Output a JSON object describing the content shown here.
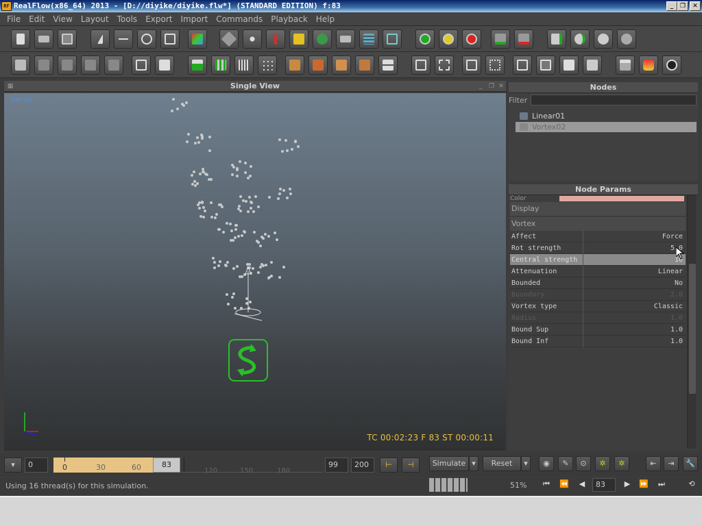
{
  "window": {
    "title": "RealFlow(x86_64) 2013 - [D://diyike/diyike.flw*] (STANDARD EDITION) f:83",
    "icon_text": "RF"
  },
  "menu": [
    "File",
    "Edit",
    "View",
    "Layout",
    "Tools",
    "Export",
    "Import",
    "Commands",
    "Playback",
    "Help"
  ],
  "viewport": {
    "title": "Single View",
    "camera": "persp",
    "timecode": "TC 00:02:23   F 83   ST 00:00:11"
  },
  "nodes": {
    "title": "Nodes",
    "filter_label": "Filter",
    "filter_value": "",
    "items": [
      {
        "name": "Linear01"
      },
      {
        "name": "Vortex02"
      }
    ]
  },
  "node_params": {
    "title": "Node Params",
    "color_label": "Color",
    "section_display": "Display",
    "section_vortex": "Vortex",
    "rows": [
      {
        "key": "Affect",
        "value": "Force"
      },
      {
        "key": "Rot strength",
        "value": "5.0"
      },
      {
        "key": "Central strength",
        "value": "10"
      },
      {
        "key": "Attenuation",
        "value": "Linear"
      },
      {
        "key": "Bounded",
        "value": "No"
      },
      {
        "key": "Boundary",
        "value": "2.0"
      },
      {
        "key": "Vortex type",
        "value": "Classic"
      },
      {
        "key": "Radius",
        "value": "1.0"
      },
      {
        "key": "Bound Sup",
        "value": "1.0"
      },
      {
        "key": "Bound Inf",
        "value": "1.0"
      }
    ]
  },
  "timeline": {
    "start": "0",
    "range_ticks": [
      "0",
      "30",
      "60"
    ],
    "current": "83",
    "ticks": [
      "120",
      "150",
      "180"
    ],
    "end_field": "99",
    "max_field": "200",
    "simulate_label": "Simulate",
    "reset_label": "Reset"
  },
  "status": {
    "message": "Using 16 thread(s) for this simulation.",
    "percent": "51%",
    "frame": "83"
  },
  "colors": {
    "accent_green": "#29c02a",
    "timecode": "#e8c040",
    "range": "#e8c484",
    "color_swatch": "#e0a8a0"
  }
}
